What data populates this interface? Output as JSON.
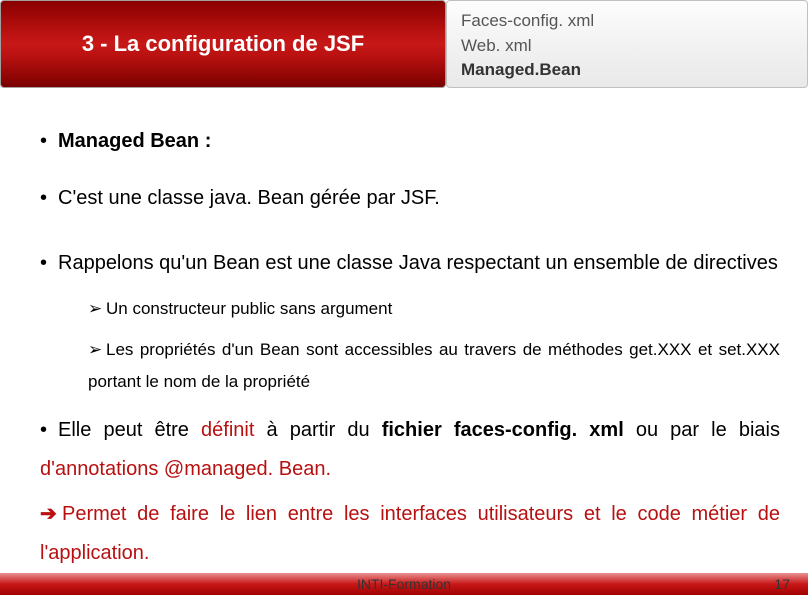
{
  "header": {
    "title": "3 - La configuration de JSF",
    "side": {
      "line1": "Faces-config. xml",
      "line2": "Web. xml",
      "line3": "Managed.Bean"
    }
  },
  "bullets": {
    "b1": "Managed Bean :",
    "b2": "C'est une classe java. Bean gérée par JSF.",
    "b3": "Rappelons qu'un Bean est une classe Java respectant un ensemble de directives",
    "sub1": "Un constructeur public sans argument",
    "sub2": "Les propriétés d'un Bean sont accessibles au travers de méthodes get.XXX et set.XXX portant le nom de la propriété",
    "b4_p1": "Elle peut être ",
    "b4_red1": "définit ",
    "b4_p2": "à partir du ",
    "b4_bold": "fichier faces-config. xml ",
    "b4_p3": "ou par le biais ",
    "b4_red2": "d'annotations @managed. Bean.",
    "b5": "Permet de faire le lien entre les interfaces utilisateurs et le code métier de l'application."
  },
  "footer": {
    "center": "INTI-Formation",
    "page": "17"
  }
}
